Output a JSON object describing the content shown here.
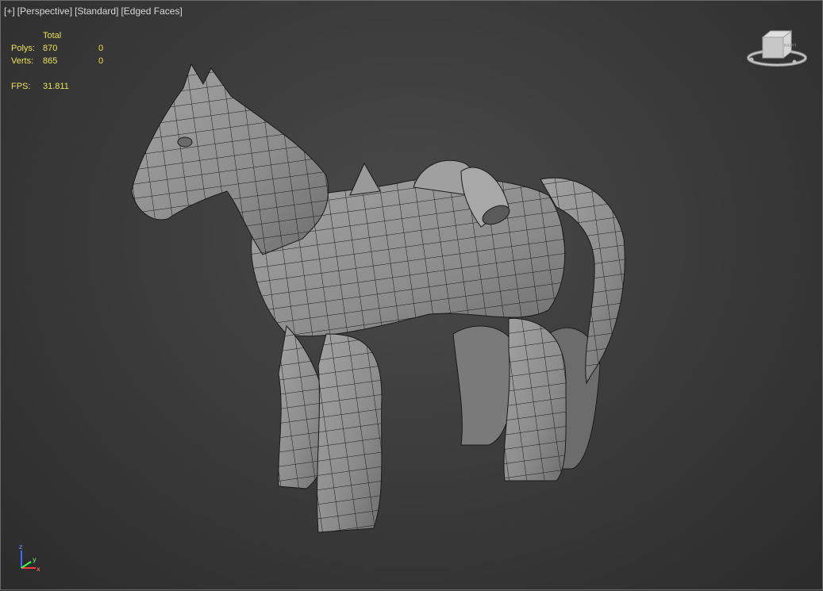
{
  "viewport": {
    "labels": [
      "[+]",
      "[Perspective]",
      "[Standard]",
      "[Edged Faces]"
    ]
  },
  "stats": {
    "header": "Total",
    "polys_label": "Polys:",
    "polys_value": "870",
    "polys_selected": "0",
    "verts_label": "Verts:",
    "verts_value": "865",
    "verts_selected": "0",
    "fps_label": "FPS:",
    "fps_value": "31.811"
  },
  "viewcube": {
    "face_label": "RIGHT"
  },
  "axis": {
    "z": "z",
    "x": "x",
    "y": "y"
  },
  "colors": {
    "stats_text": "#e8e15a",
    "label_text": "#d8d8d8",
    "mesh_fill": "#8f8f8f",
    "mesh_edge": "#1a1a1a"
  }
}
